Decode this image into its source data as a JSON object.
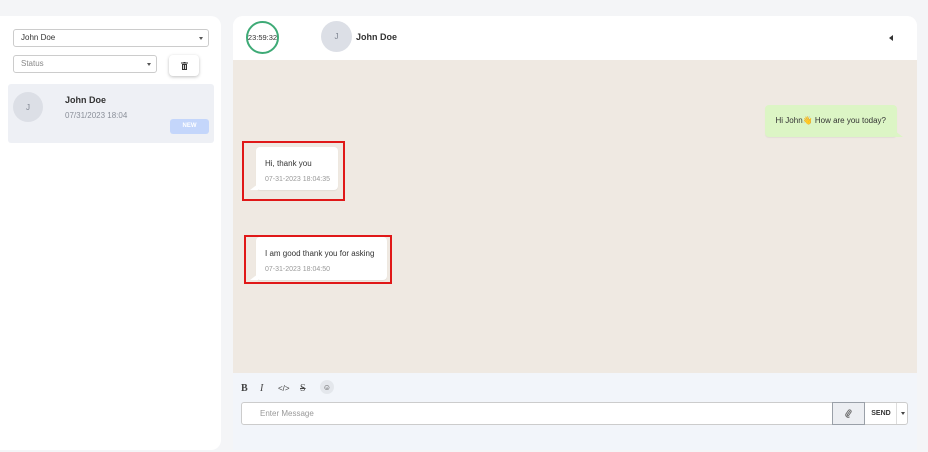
{
  "sidebar": {
    "user_select_value": "John Doe",
    "status_select_placeholder": "Status",
    "contact": {
      "avatar_initial": "J",
      "name": "John Doe",
      "date": "07/31/2023 18:04",
      "badge": "NEW"
    }
  },
  "header": {
    "timer": "23:59:32",
    "avatar_initial": "J",
    "name": "John Doe"
  },
  "messages": [
    {
      "direction": "outgoing",
      "text": "Hi John👋 How are you today?"
    },
    {
      "direction": "incoming",
      "text": "Hi, thank you",
      "time": "07-31-2023 18:04:35"
    },
    {
      "direction": "incoming",
      "text": "I am good thank you for asking",
      "time": "07-31-2023 18:04:50"
    }
  ],
  "toolbar": {
    "bold": "B",
    "italic": "I",
    "code": "</>",
    "strike": "S",
    "emoji": "☺"
  },
  "composer": {
    "placeholder": "Enter Message",
    "send_label": "SEND"
  },
  "colors": {
    "timer_ring": "#3eaa76",
    "chat_background": "#efe9e2",
    "outgoing_bubble": "#dcf5c5",
    "highlight_box": "#e01818",
    "new_badge": "#c4d6fb"
  },
  "icons": [
    "chevron-down-icon",
    "trash-icon",
    "collapse-arrow-icon",
    "paperclip-icon",
    "emoji-icon"
  ]
}
